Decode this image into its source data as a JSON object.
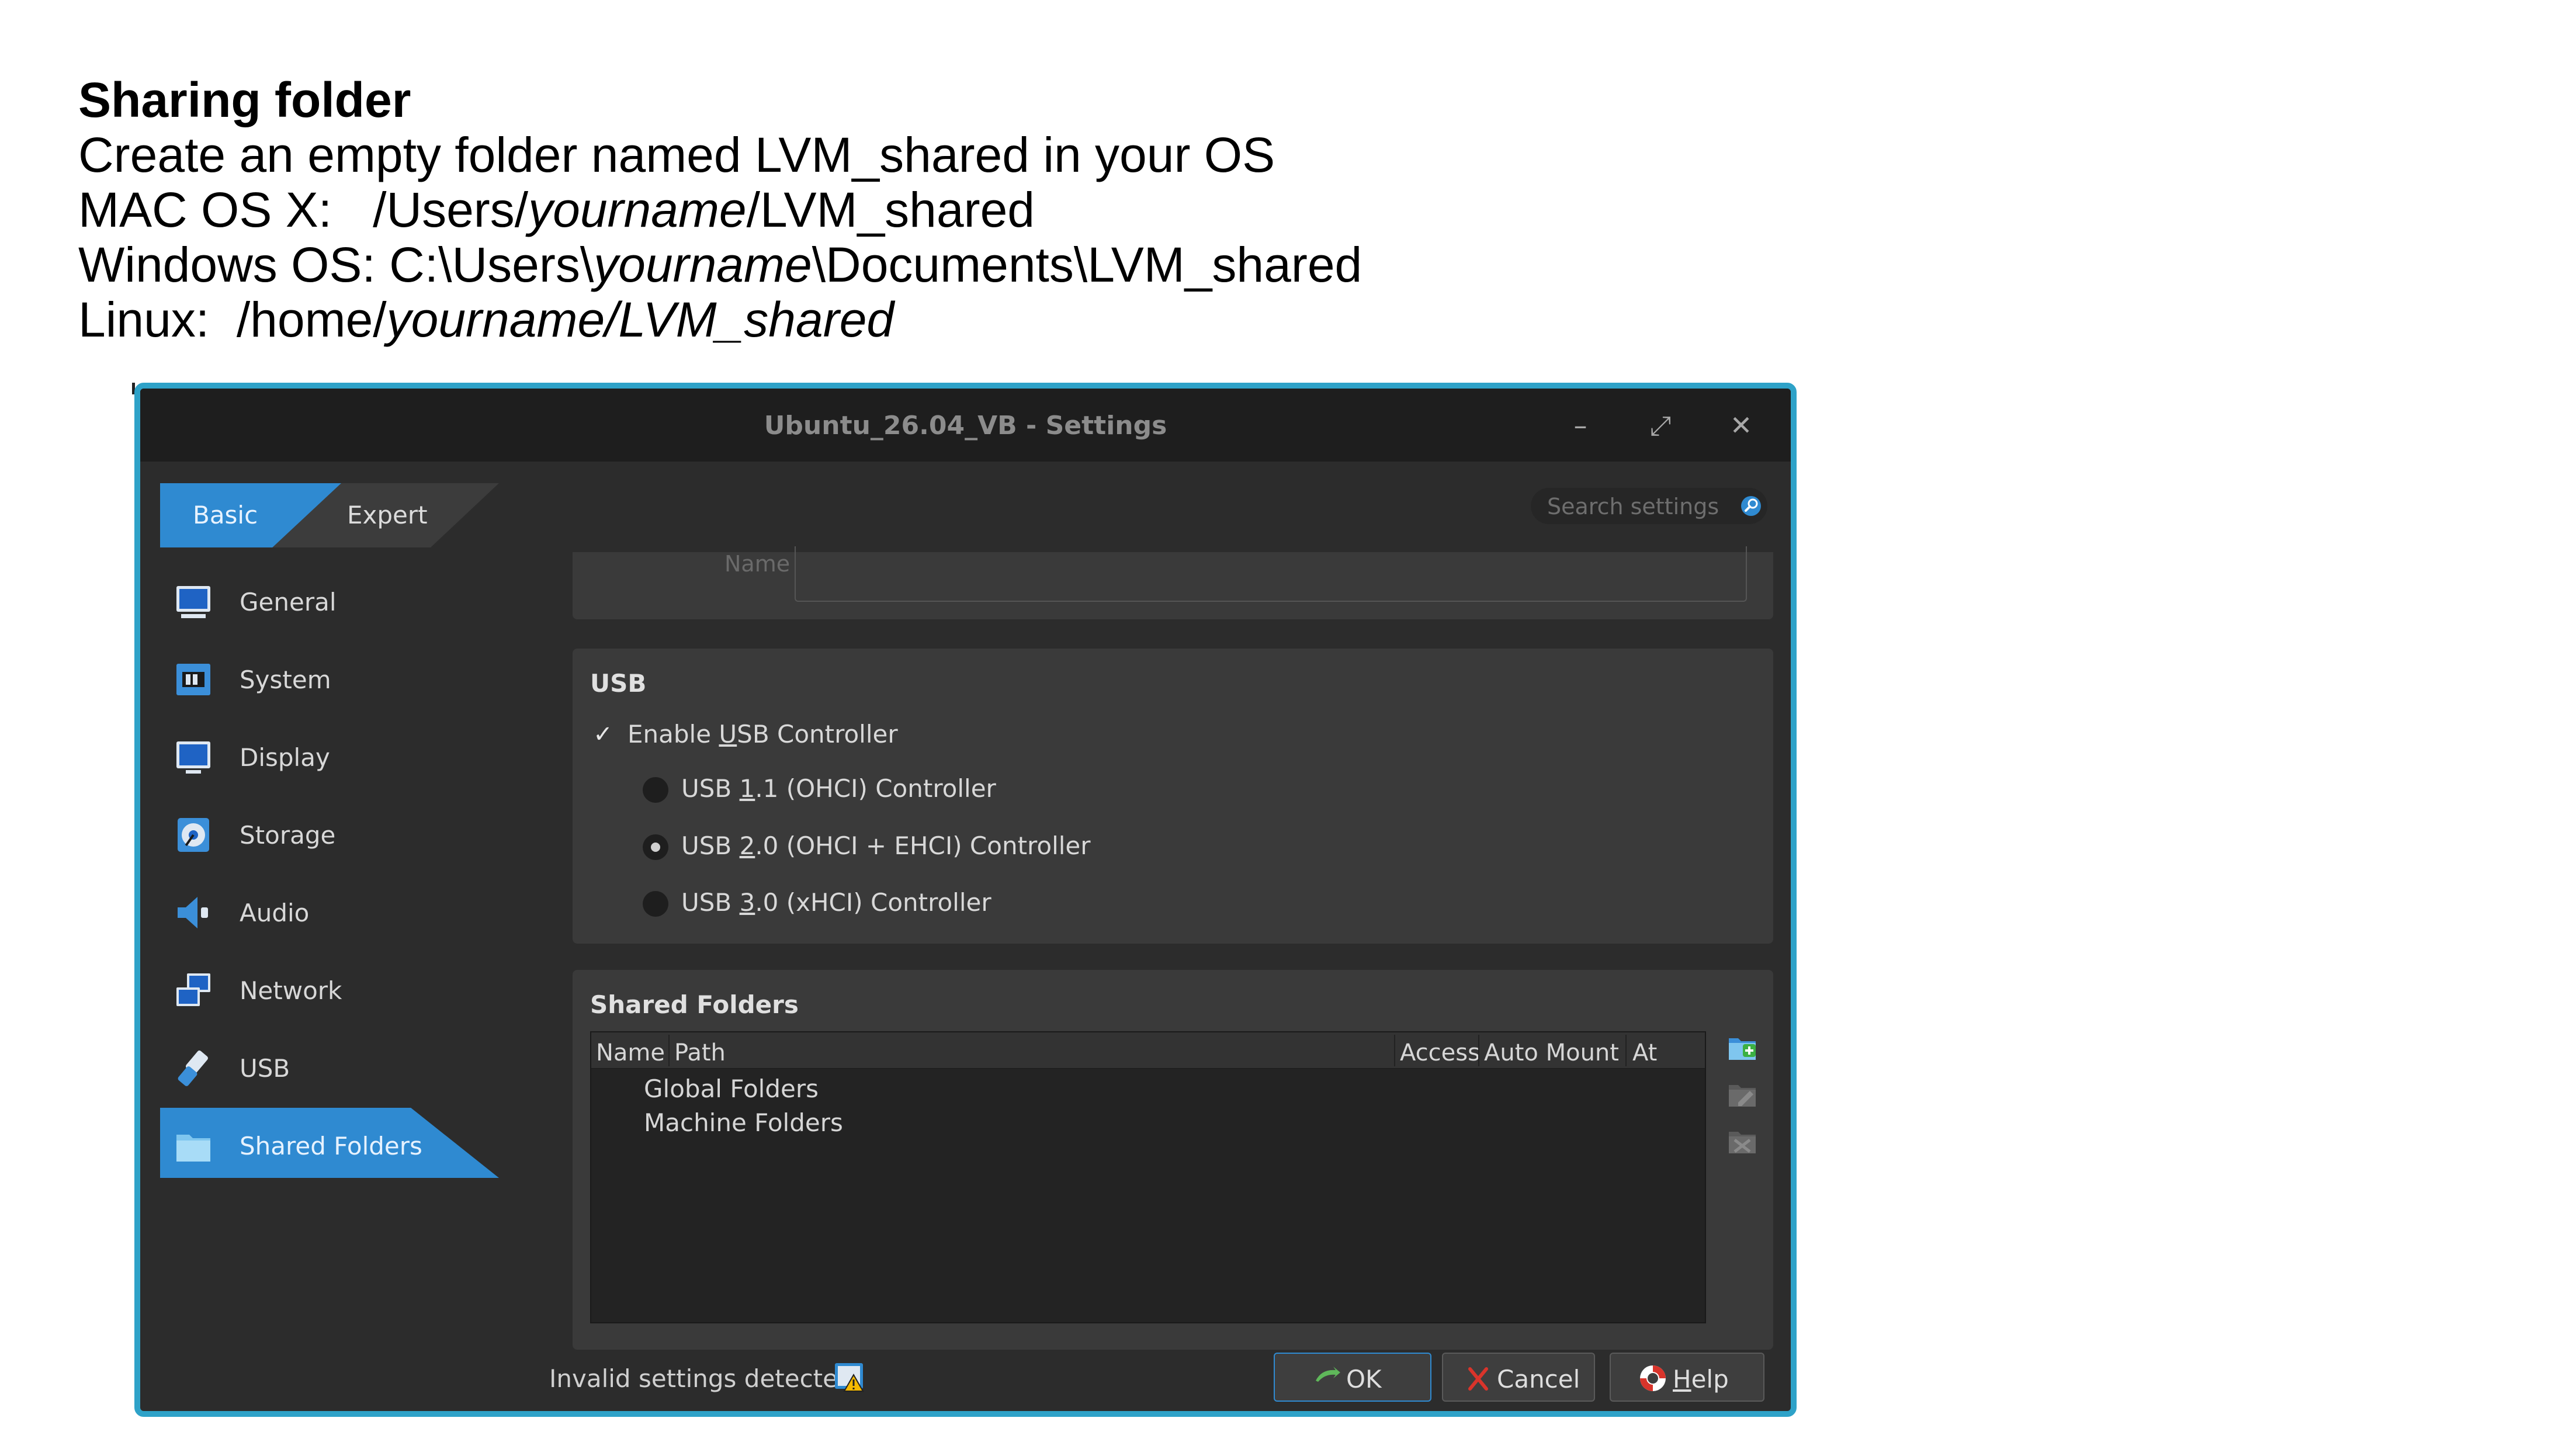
{
  "slide": {
    "heading": "Sharing folder",
    "line1": "Create an empty folder named LVM_shared in your OS",
    "mac": {
      "prefix": "MAC OS X:   /Users/",
      "user": "yourname",
      "suffix": "/LVM_shared"
    },
    "windows": {
      "prefix": "Windows OS: C:\\Users\\",
      "user": "yourname",
      "suffix": "\\Documents\\LVM_shared"
    },
    "linux": {
      "prefix": "Linux:  /home/",
      "user": "yourname/LVM_shared"
    }
  },
  "window": {
    "title": "Ubuntu_26.04_VB - Settings",
    "controls": {
      "minimize": "–",
      "maximize": "⤢",
      "close": "✕"
    }
  },
  "mode_tabs": {
    "basic": "Basic",
    "expert": "Expert"
  },
  "search": {
    "placeholder": "Search settings"
  },
  "sidebar": {
    "items": [
      {
        "label": "General",
        "icon": "monitor-icon"
      },
      {
        "label": "System",
        "icon": "chip-icon"
      },
      {
        "label": "Display",
        "icon": "display-icon"
      },
      {
        "label": "Storage",
        "icon": "disk-icon"
      },
      {
        "label": "Audio",
        "icon": "speaker-icon"
      },
      {
        "label": "Network",
        "icon": "network-icon"
      },
      {
        "label": "USB",
        "icon": "usb-icon"
      },
      {
        "label": "Shared Folders",
        "icon": "folder-icon"
      }
    ],
    "active": "Shared Folders"
  },
  "top_group": {
    "name_label": "Name"
  },
  "usb": {
    "title": "USB",
    "enable": {
      "pre": "Enable ",
      "u": "U",
      "post": "SB Controller",
      "checked": true
    },
    "options": [
      {
        "pre": "USB ",
        "u": "1",
        "post": ".1 (OHCI) Controller",
        "selected": false
      },
      {
        "pre": "USB ",
        "u": "2",
        "post": ".0 (OHCI + EHCI) Controller",
        "selected": true
      },
      {
        "pre": "USB ",
        "u": "3",
        "post": ".0 (xHCI) Controller",
        "selected": false
      }
    ]
  },
  "shared_folders": {
    "title": "Shared Folders",
    "columns": [
      "Name",
      "Path",
      "Access",
      "Auto Mount",
      "At"
    ],
    "rows": [
      "Global Folders",
      "Machine Folders"
    ]
  },
  "footer": {
    "invalid_text": "Invalid settings detected",
    "ok": "OK",
    "cancel": "Cancel",
    "help_u": "H",
    "help_rest": "elp"
  },
  "colors": {
    "accent": "#2f8ad1",
    "window_border": "#2ea2c8",
    "background": "#2c2c2c"
  }
}
